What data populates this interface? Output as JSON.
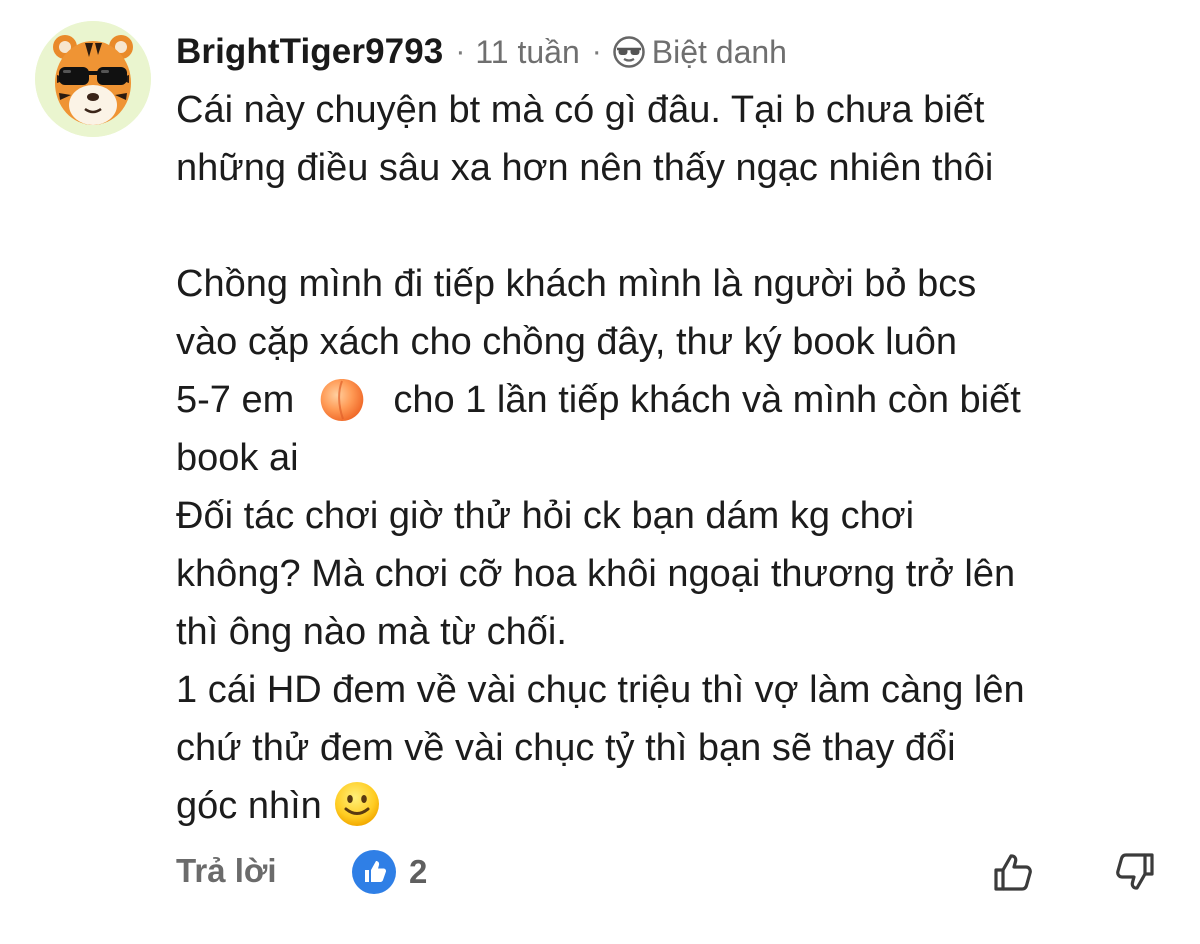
{
  "comment": {
    "username": "BrightTiger9793",
    "separator_1": "·",
    "time": "11 tuần",
    "separator_2": "·",
    "badge_label": "Biệt danh",
    "avatar_icon": "tiger-sunglasses-avatar",
    "badge_icon": "sunglasses-icon",
    "lines": [
      "Cái này chuyện bt mà có gì đâu. Tại b chưa biết",
      "những điều sâu xa hơn nên thấy ngạc nhiên thôi",
      "",
      "Chồng mình đi tiếp khách mình là người bỏ bcs",
      "vào cặp xách cho chồng đây, thư ký book luôn",
      "5-7 em",
      "cho 1 lần tiếp khách và mình còn biết",
      "book ai",
      "Đối tác chơi giờ thử hỏi ck bạn dám kg chơi",
      "không? Mà chơi cỡ hoa khôi ngoại thương trở lên",
      "thì ông nào mà từ chối.",
      "1 cái HD đem về vài chục triệu thì vợ làm càng lên",
      "chứ thử  đem về vài chục tỷ thì bạn sẽ thay đổi",
      "góc nhìn"
    ],
    "inline_emojis": [
      "peach-emoji",
      "smiling-face-emoji"
    ]
  },
  "footer": {
    "reply_label": "Trả lời",
    "reaction_icon": "blue-thumbs-up-icon",
    "reaction_count": "2",
    "like_icon": "thumbs-up-outline-icon",
    "dislike_icon": "thumbs-down-outline-icon"
  },
  "colors": {
    "username": "#1a1a1a",
    "meta": "#6f6f6f",
    "body_text": "#1c1c1c",
    "reaction_blue": "#2f7fe6",
    "avatar_bg": "#eaf5cf"
  }
}
